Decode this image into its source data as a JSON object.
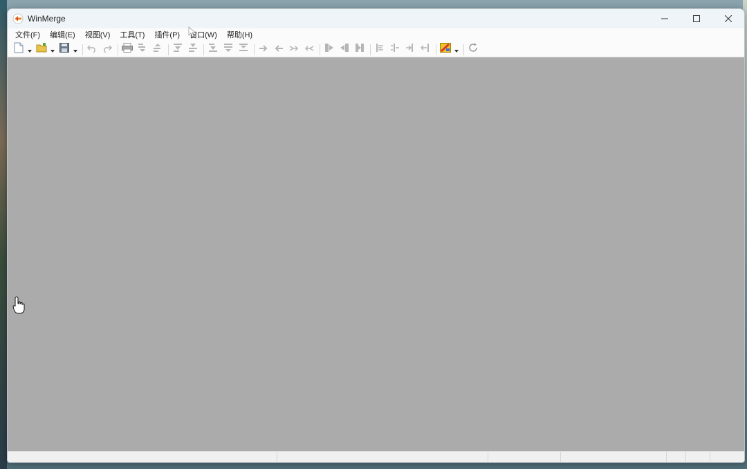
{
  "window": {
    "title": "WinMerge",
    "controls": {
      "minimize_icon": "minimize-icon",
      "maximize_icon": "maximize-icon",
      "close_icon": "close-icon"
    }
  },
  "menubar": {
    "items": [
      {
        "label": "文件(F)"
      },
      {
        "label": "编辑(E)"
      },
      {
        "label": "视图(V)"
      },
      {
        "label": "工具(T)"
      },
      {
        "label": "插件(P)"
      },
      {
        "label": "窗口(W)"
      },
      {
        "label": "帮助(H)"
      }
    ]
  },
  "toolbar": {
    "buttons": [
      {
        "icon": "new-document-icon"
      },
      {
        "icon": "open-folder-icon"
      },
      {
        "icon": "save-icon"
      },
      {
        "icon": "undo-icon"
      },
      {
        "icon": "redo-icon"
      },
      {
        "icon": "print-icon"
      },
      {
        "icon": "next-diff-icon"
      },
      {
        "icon": "prev-diff-icon"
      },
      {
        "icon": "first-diff-icon"
      },
      {
        "icon": "current-diff-icon"
      },
      {
        "icon": "last-diff-icon"
      },
      {
        "icon": "copy-right-icon"
      },
      {
        "icon": "copy-left-icon"
      },
      {
        "icon": "copy-right-advance-icon"
      },
      {
        "icon": "copy-left-advance-icon"
      },
      {
        "icon": "all-right-icon"
      },
      {
        "icon": "all-left-icon"
      },
      {
        "icon": "merge-all-icon"
      },
      {
        "icon": "options-icon"
      },
      {
        "icon": "refresh-icon"
      }
    ]
  },
  "colors": {
    "mdi_background": "#ababab",
    "titlebar": "#eef4f8",
    "accent_orange": "#e8842a"
  }
}
